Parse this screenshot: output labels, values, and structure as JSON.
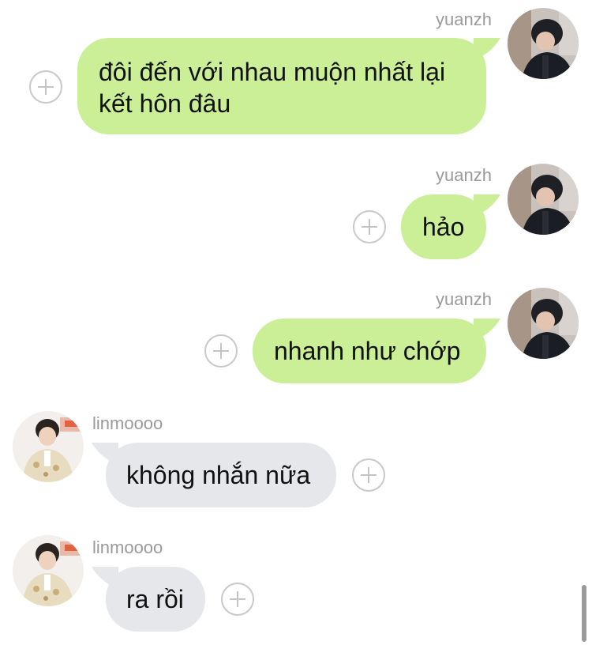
{
  "messages": [
    {
      "sender": "yuanzh",
      "text": "đôi đến với nhau muộn nhất lại\nkết hôn đâu",
      "direction": "outgoing",
      "avatar": "avatar-yuanzh"
    },
    {
      "sender": "yuanzh",
      "text": "hảo",
      "direction": "outgoing",
      "avatar": "avatar-yuanzh"
    },
    {
      "sender": "yuanzh",
      "text": "nhanh như chớp",
      "direction": "outgoing",
      "avatar": "avatar-yuanzh"
    },
    {
      "sender": "linmoooo",
      "text": "không nhắn nữa",
      "direction": "incoming",
      "avatar": "avatar-linmoooo"
    },
    {
      "sender": "linmoooo",
      "text": "ra rồi",
      "direction": "incoming",
      "avatar": "avatar-linmoooo"
    }
  ],
  "colors": {
    "outgoing_bubble": "#cbef97",
    "incoming_bubble": "#e5e7eb",
    "sender_text": "#9a9a9a"
  },
  "icons": {
    "add_reaction": "plus-circle-icon"
  }
}
